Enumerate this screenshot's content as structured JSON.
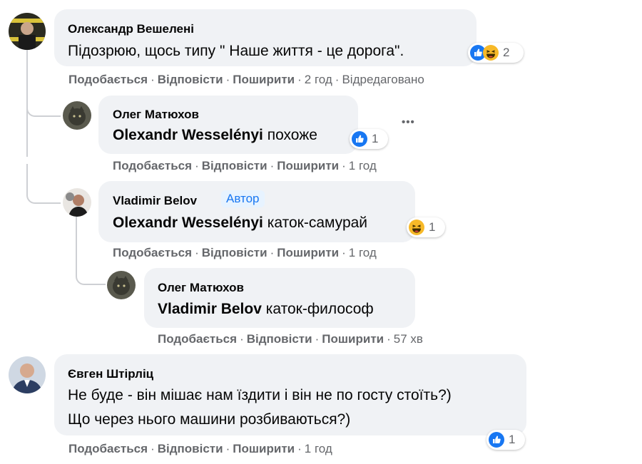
{
  "actions_labels": {
    "like": "Подобається",
    "reply": "Відповісти",
    "share": "Поширити"
  },
  "comments": [
    {
      "author": "Олександр Вешелені",
      "text": "Підозрюю, щось типу \" Наше життя - це дорога\".",
      "reactions": {
        "icons": [
          "like-icon",
          "haha-icon"
        ],
        "count": "2"
      },
      "time": "2 год",
      "edited": "Відредаговано"
    },
    {
      "author": "Олег Матюхов",
      "mention": "Olexandr Wesselényi",
      "text": " похоже",
      "reactions": {
        "icons": [
          "like-icon"
        ],
        "count": "1"
      },
      "time": "1 год",
      "more": "•••"
    },
    {
      "author": "Vladimir Belov",
      "badge": "Автор",
      "mention": "Olexandr Wesselényi",
      "text": " каток-самурай",
      "reactions": {
        "icons": [
          "haha-icon"
        ],
        "count": "1"
      },
      "time": "1 год"
    },
    {
      "author": "Олег Матюхов",
      "mention": "Vladimir Belov",
      "text": " каток-философ",
      "time": "57 хв"
    },
    {
      "author": "Євген Штірліц",
      "text_line1": "Не буде - він мішає нам їздити і він не по госту стоїть?)",
      "text_line2": "Що через нього машини розбиваються?)",
      "reactions": {
        "icons": [
          "like-icon"
        ],
        "count": "1"
      },
      "time": "1 год"
    }
  ],
  "colors": {
    "bubble": "#f0f2f5",
    "secondary_text": "#65676b",
    "like_blue": "#1877f2",
    "haha_yellow": "#f7b928",
    "badge_bg": "#e7f3ff"
  }
}
